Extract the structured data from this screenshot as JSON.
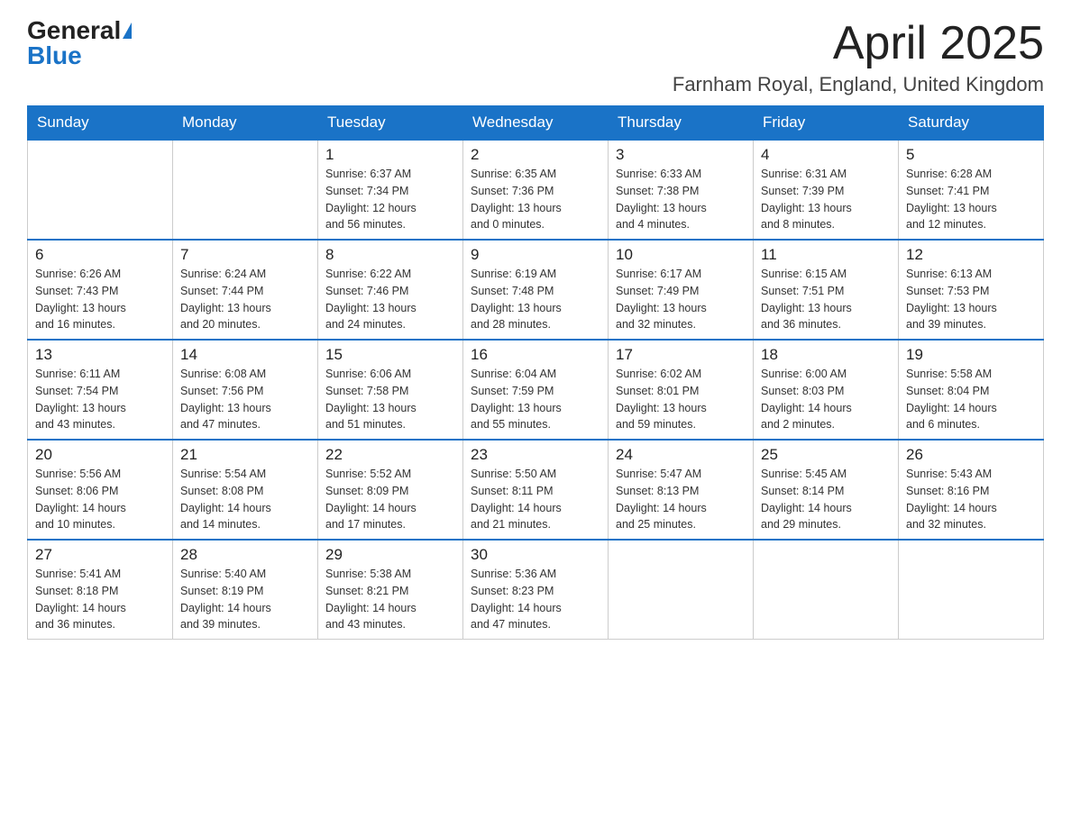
{
  "logo": {
    "general": "General",
    "blue": "Blue"
  },
  "title": "April 2025",
  "location": "Farnham Royal, England, United Kingdom",
  "weekdays": [
    "Sunday",
    "Monday",
    "Tuesday",
    "Wednesday",
    "Thursday",
    "Friday",
    "Saturday"
  ],
  "weeks": [
    [
      {
        "day": "",
        "info": ""
      },
      {
        "day": "",
        "info": ""
      },
      {
        "day": "1",
        "info": "Sunrise: 6:37 AM\nSunset: 7:34 PM\nDaylight: 12 hours\nand 56 minutes."
      },
      {
        "day": "2",
        "info": "Sunrise: 6:35 AM\nSunset: 7:36 PM\nDaylight: 13 hours\nand 0 minutes."
      },
      {
        "day": "3",
        "info": "Sunrise: 6:33 AM\nSunset: 7:38 PM\nDaylight: 13 hours\nand 4 minutes."
      },
      {
        "day": "4",
        "info": "Sunrise: 6:31 AM\nSunset: 7:39 PM\nDaylight: 13 hours\nand 8 minutes."
      },
      {
        "day": "5",
        "info": "Sunrise: 6:28 AM\nSunset: 7:41 PM\nDaylight: 13 hours\nand 12 minutes."
      }
    ],
    [
      {
        "day": "6",
        "info": "Sunrise: 6:26 AM\nSunset: 7:43 PM\nDaylight: 13 hours\nand 16 minutes."
      },
      {
        "day": "7",
        "info": "Sunrise: 6:24 AM\nSunset: 7:44 PM\nDaylight: 13 hours\nand 20 minutes."
      },
      {
        "day": "8",
        "info": "Sunrise: 6:22 AM\nSunset: 7:46 PM\nDaylight: 13 hours\nand 24 minutes."
      },
      {
        "day": "9",
        "info": "Sunrise: 6:19 AM\nSunset: 7:48 PM\nDaylight: 13 hours\nand 28 minutes."
      },
      {
        "day": "10",
        "info": "Sunrise: 6:17 AM\nSunset: 7:49 PM\nDaylight: 13 hours\nand 32 minutes."
      },
      {
        "day": "11",
        "info": "Sunrise: 6:15 AM\nSunset: 7:51 PM\nDaylight: 13 hours\nand 36 minutes."
      },
      {
        "day": "12",
        "info": "Sunrise: 6:13 AM\nSunset: 7:53 PM\nDaylight: 13 hours\nand 39 minutes."
      }
    ],
    [
      {
        "day": "13",
        "info": "Sunrise: 6:11 AM\nSunset: 7:54 PM\nDaylight: 13 hours\nand 43 minutes."
      },
      {
        "day": "14",
        "info": "Sunrise: 6:08 AM\nSunset: 7:56 PM\nDaylight: 13 hours\nand 47 minutes."
      },
      {
        "day": "15",
        "info": "Sunrise: 6:06 AM\nSunset: 7:58 PM\nDaylight: 13 hours\nand 51 minutes."
      },
      {
        "day": "16",
        "info": "Sunrise: 6:04 AM\nSunset: 7:59 PM\nDaylight: 13 hours\nand 55 minutes."
      },
      {
        "day": "17",
        "info": "Sunrise: 6:02 AM\nSunset: 8:01 PM\nDaylight: 13 hours\nand 59 minutes."
      },
      {
        "day": "18",
        "info": "Sunrise: 6:00 AM\nSunset: 8:03 PM\nDaylight: 14 hours\nand 2 minutes."
      },
      {
        "day": "19",
        "info": "Sunrise: 5:58 AM\nSunset: 8:04 PM\nDaylight: 14 hours\nand 6 minutes."
      }
    ],
    [
      {
        "day": "20",
        "info": "Sunrise: 5:56 AM\nSunset: 8:06 PM\nDaylight: 14 hours\nand 10 minutes."
      },
      {
        "day": "21",
        "info": "Sunrise: 5:54 AM\nSunset: 8:08 PM\nDaylight: 14 hours\nand 14 minutes."
      },
      {
        "day": "22",
        "info": "Sunrise: 5:52 AM\nSunset: 8:09 PM\nDaylight: 14 hours\nand 17 minutes."
      },
      {
        "day": "23",
        "info": "Sunrise: 5:50 AM\nSunset: 8:11 PM\nDaylight: 14 hours\nand 21 minutes."
      },
      {
        "day": "24",
        "info": "Sunrise: 5:47 AM\nSunset: 8:13 PM\nDaylight: 14 hours\nand 25 minutes."
      },
      {
        "day": "25",
        "info": "Sunrise: 5:45 AM\nSunset: 8:14 PM\nDaylight: 14 hours\nand 29 minutes."
      },
      {
        "day": "26",
        "info": "Sunrise: 5:43 AM\nSunset: 8:16 PM\nDaylight: 14 hours\nand 32 minutes."
      }
    ],
    [
      {
        "day": "27",
        "info": "Sunrise: 5:41 AM\nSunset: 8:18 PM\nDaylight: 14 hours\nand 36 minutes."
      },
      {
        "day": "28",
        "info": "Sunrise: 5:40 AM\nSunset: 8:19 PM\nDaylight: 14 hours\nand 39 minutes."
      },
      {
        "day": "29",
        "info": "Sunrise: 5:38 AM\nSunset: 8:21 PM\nDaylight: 14 hours\nand 43 minutes."
      },
      {
        "day": "30",
        "info": "Sunrise: 5:36 AM\nSunset: 8:23 PM\nDaylight: 14 hours\nand 47 minutes."
      },
      {
        "day": "",
        "info": ""
      },
      {
        "day": "",
        "info": ""
      },
      {
        "day": "",
        "info": ""
      }
    ]
  ]
}
